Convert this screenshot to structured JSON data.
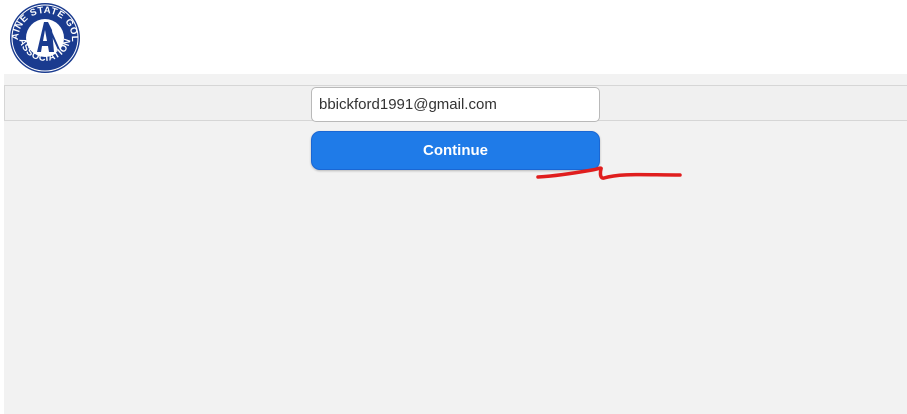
{
  "header": {
    "logo": {
      "icon": "maine-state-golf-association-logo",
      "ring_text": "MAINE STATE GOLF ASSOCIATION",
      "colors": {
        "ring": "#1a3b8f",
        "inner": "#ffffff",
        "mark": "#1a3b8f"
      }
    }
  },
  "form": {
    "email_value": "bbickford1991@gmail.com",
    "continue_label": "Continue"
  },
  "colors": {
    "accent": "#1f7be8",
    "annotation": "#e01e1e",
    "page_background": "#f2f2f2"
  }
}
